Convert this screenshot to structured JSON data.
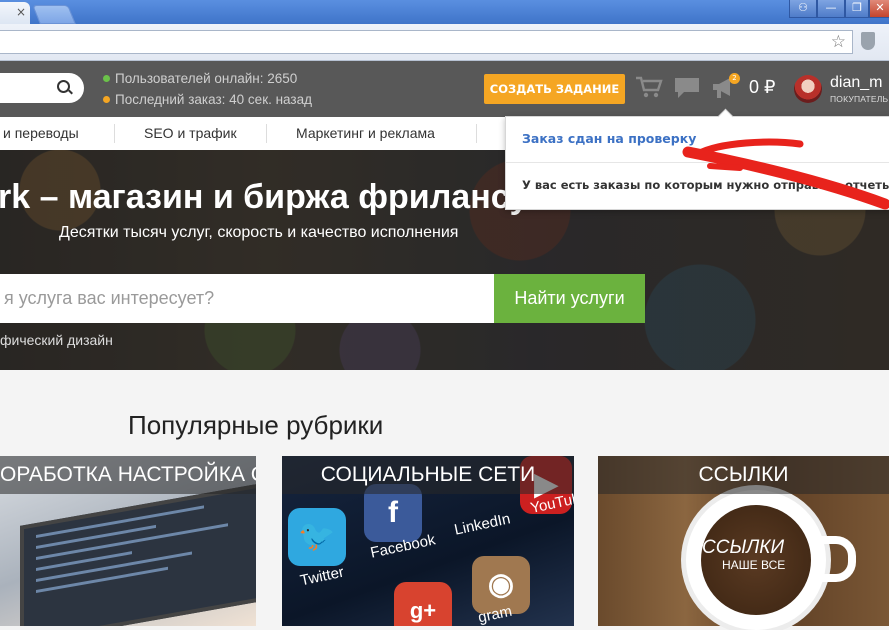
{
  "browser": {
    "tab_close": "×",
    "window_buttons": [
      "⚇",
      "—",
      "❐",
      "✕"
    ],
    "url": ""
  },
  "header": {
    "online_users": "Пользователей онлайн: 2650",
    "last_order": "Последний заказ: 40 сек. назад",
    "create_task_button": "СОЗДАТЬ ЗАДАНИЕ",
    "notification_badge": "2",
    "balance": "0 ₽",
    "username": "dian_m",
    "user_role": "ПОКУПАТЕЛЬ",
    "colors": {
      "online_dot": "#6bc24a",
      "order_dot": "#f5a623",
      "create_button": "#f5a623"
    }
  },
  "nav": {
    "items": [
      "и переводы",
      "SEO и трафик",
      "Маркетинг и реклама"
    ]
  },
  "hero": {
    "title": "rk – магазин и биржа фрилансу",
    "subtitle": "Десятки тысяч услуг, скорость и качество исполнения",
    "search_placeholder": "я услуга вас интересует?",
    "search_button": "Найти услуги",
    "hint": "фический дизайн"
  },
  "popular": {
    "title": "Популярные рубрики",
    "cards": [
      {
        "label": "ОРАБОТКА НАСТРОЙКА САЙТА"
      },
      {
        "label": "СОЦИАЛЬНЫЕ СЕТИ",
        "apps": [
          "Twitter",
          "Facebook",
          "LinkedIn",
          "YouTube",
          "gram"
        ]
      },
      {
        "label": "ССЫЛКИ",
        "cup_text_1": "ССЫЛКИ",
        "cup_text_2": "НАШЕ ВСЕ"
      }
    ]
  },
  "notification": {
    "title": "Заказ сдан на проверку",
    "text": "У вас есть заказы по которым нужно отправить отчеты"
  }
}
